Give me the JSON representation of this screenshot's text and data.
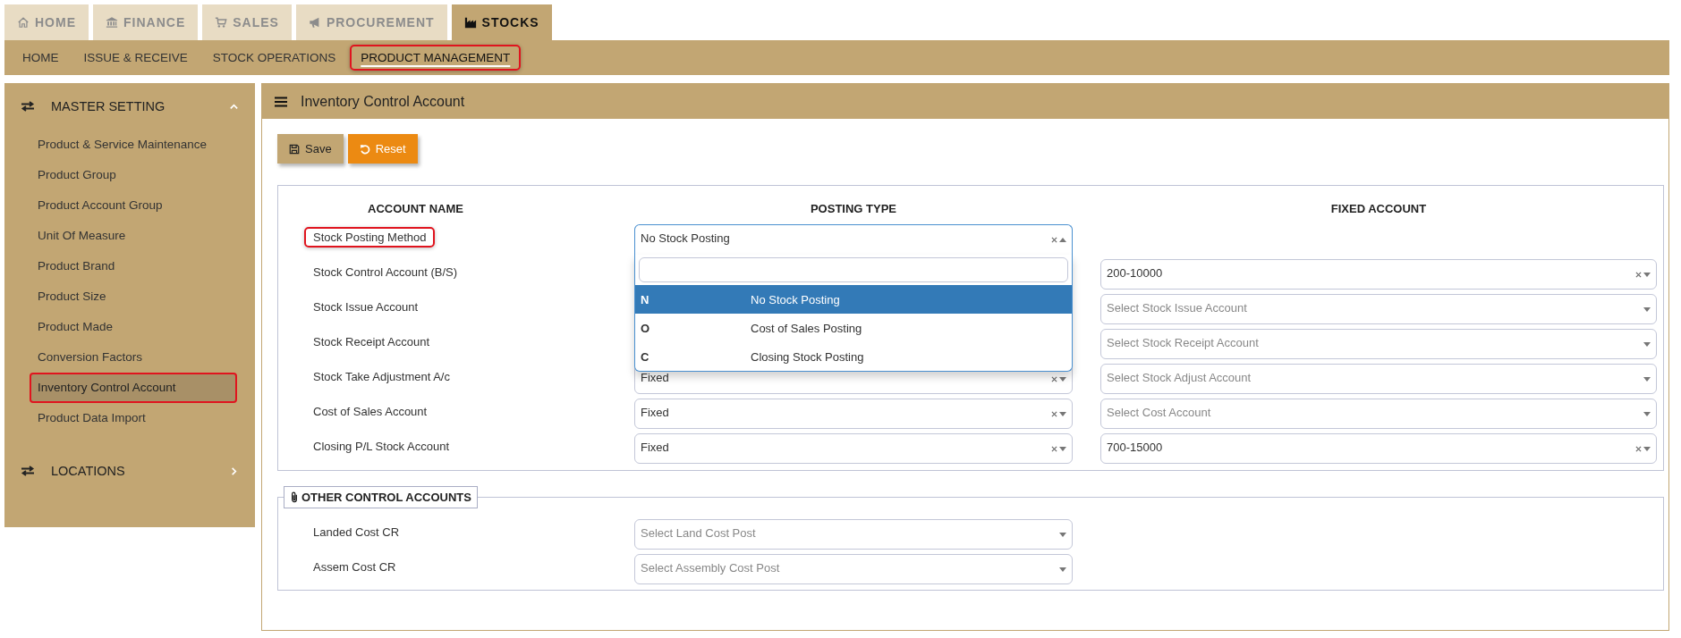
{
  "top_tabs": [
    {
      "label": "HOME",
      "selected": false
    },
    {
      "label": "FINANCE",
      "selected": false
    },
    {
      "label": "SALES",
      "selected": false
    },
    {
      "label": "PROCUREMENT",
      "selected": false
    },
    {
      "label": "STOCKS",
      "selected": true
    }
  ],
  "sub_nav": [
    {
      "label": "HOME",
      "selected": false,
      "highlighted": false
    },
    {
      "label": "ISSUE & RECEIVE",
      "selected": false,
      "highlighted": false
    },
    {
      "label": "STOCK OPERATIONS",
      "selected": false,
      "highlighted": false
    },
    {
      "label": "PRODUCT MANAGEMENT",
      "selected": true,
      "highlighted": true
    }
  ],
  "sidebar": {
    "sections": [
      {
        "title": "MASTER SETTING",
        "expanded": true,
        "items": [
          {
            "label": "Product & Service Maintenance",
            "selected": false,
            "highlighted": false
          },
          {
            "label": "Product Group",
            "selected": false,
            "highlighted": false
          },
          {
            "label": "Product Account Group",
            "selected": false,
            "highlighted": false
          },
          {
            "label": "Unit Of Measure",
            "selected": false,
            "highlighted": false
          },
          {
            "label": "Product Brand",
            "selected": false,
            "highlighted": false
          },
          {
            "label": "Product Size",
            "selected": false,
            "highlighted": false
          },
          {
            "label": "Product Made",
            "selected": false,
            "highlighted": false
          },
          {
            "label": "Conversion Factors",
            "selected": false,
            "highlighted": false
          },
          {
            "label": "Inventory Control Account",
            "selected": true,
            "highlighted": true
          },
          {
            "label": "Product Data Import",
            "selected": false,
            "highlighted": false
          }
        ]
      },
      {
        "title": "LOCATIONS",
        "expanded": false
      }
    ]
  },
  "panel": {
    "title": "Inventory Control Account",
    "buttons": [
      {
        "label": "Save",
        "kind": "save"
      },
      {
        "label": "Reset",
        "kind": "reset"
      }
    ],
    "columns": [
      "ACCOUNT NAME",
      "POSTING TYPE",
      "FIXED ACCOUNT"
    ],
    "rows": [
      {
        "name": "Stock Posting Method",
        "highlighted": true,
        "posting": {
          "value": "No Stock Posting",
          "open": true
        }
      },
      {
        "name": "Stock Control Account (B/S)",
        "highlighted": false,
        "account": {
          "value": "200-10000"
        }
      },
      {
        "name": "Stock Issue Account",
        "highlighted": false,
        "account": {
          "placeholder": "Select Stock Issue Account"
        }
      },
      {
        "name": "Stock Receipt Account",
        "highlighted": false,
        "account": {
          "placeholder": "Select Stock Receipt Account"
        }
      },
      {
        "name": "Stock Take Adjustment A/c",
        "highlighted": false,
        "posting": {
          "value": "Fixed",
          "open": false
        },
        "account": {
          "placeholder": "Select Stock Adjust Account"
        }
      },
      {
        "name": "Cost of Sales Account",
        "highlighted": false,
        "posting": {
          "value": "Fixed",
          "open": false
        },
        "account": {
          "placeholder": "Select Cost Account"
        }
      },
      {
        "name": "Closing P/L Stock Account",
        "highlighted": false,
        "posting": {
          "value": "Fixed",
          "open": false
        },
        "account": {
          "value": "700-15000"
        }
      }
    ],
    "dropdown": {
      "options": [
        {
          "code": "N",
          "label": "No Stock Posting",
          "selected": true
        },
        {
          "code": "O",
          "label": "Cost of Sales Posting",
          "selected": false
        },
        {
          "code": "C",
          "label": "Closing Stock Posting",
          "selected": false
        }
      ]
    },
    "other": {
      "title": "OTHER CONTROL ACCOUNTS",
      "rows": [
        {
          "name": "Landed Cost CR",
          "field": {
            "placeholder": "Select Land Cost Post"
          }
        },
        {
          "name": "Assem Cost CR",
          "field": {
            "placeholder": "Select Assembly Cost Post"
          }
        }
      ]
    }
  }
}
